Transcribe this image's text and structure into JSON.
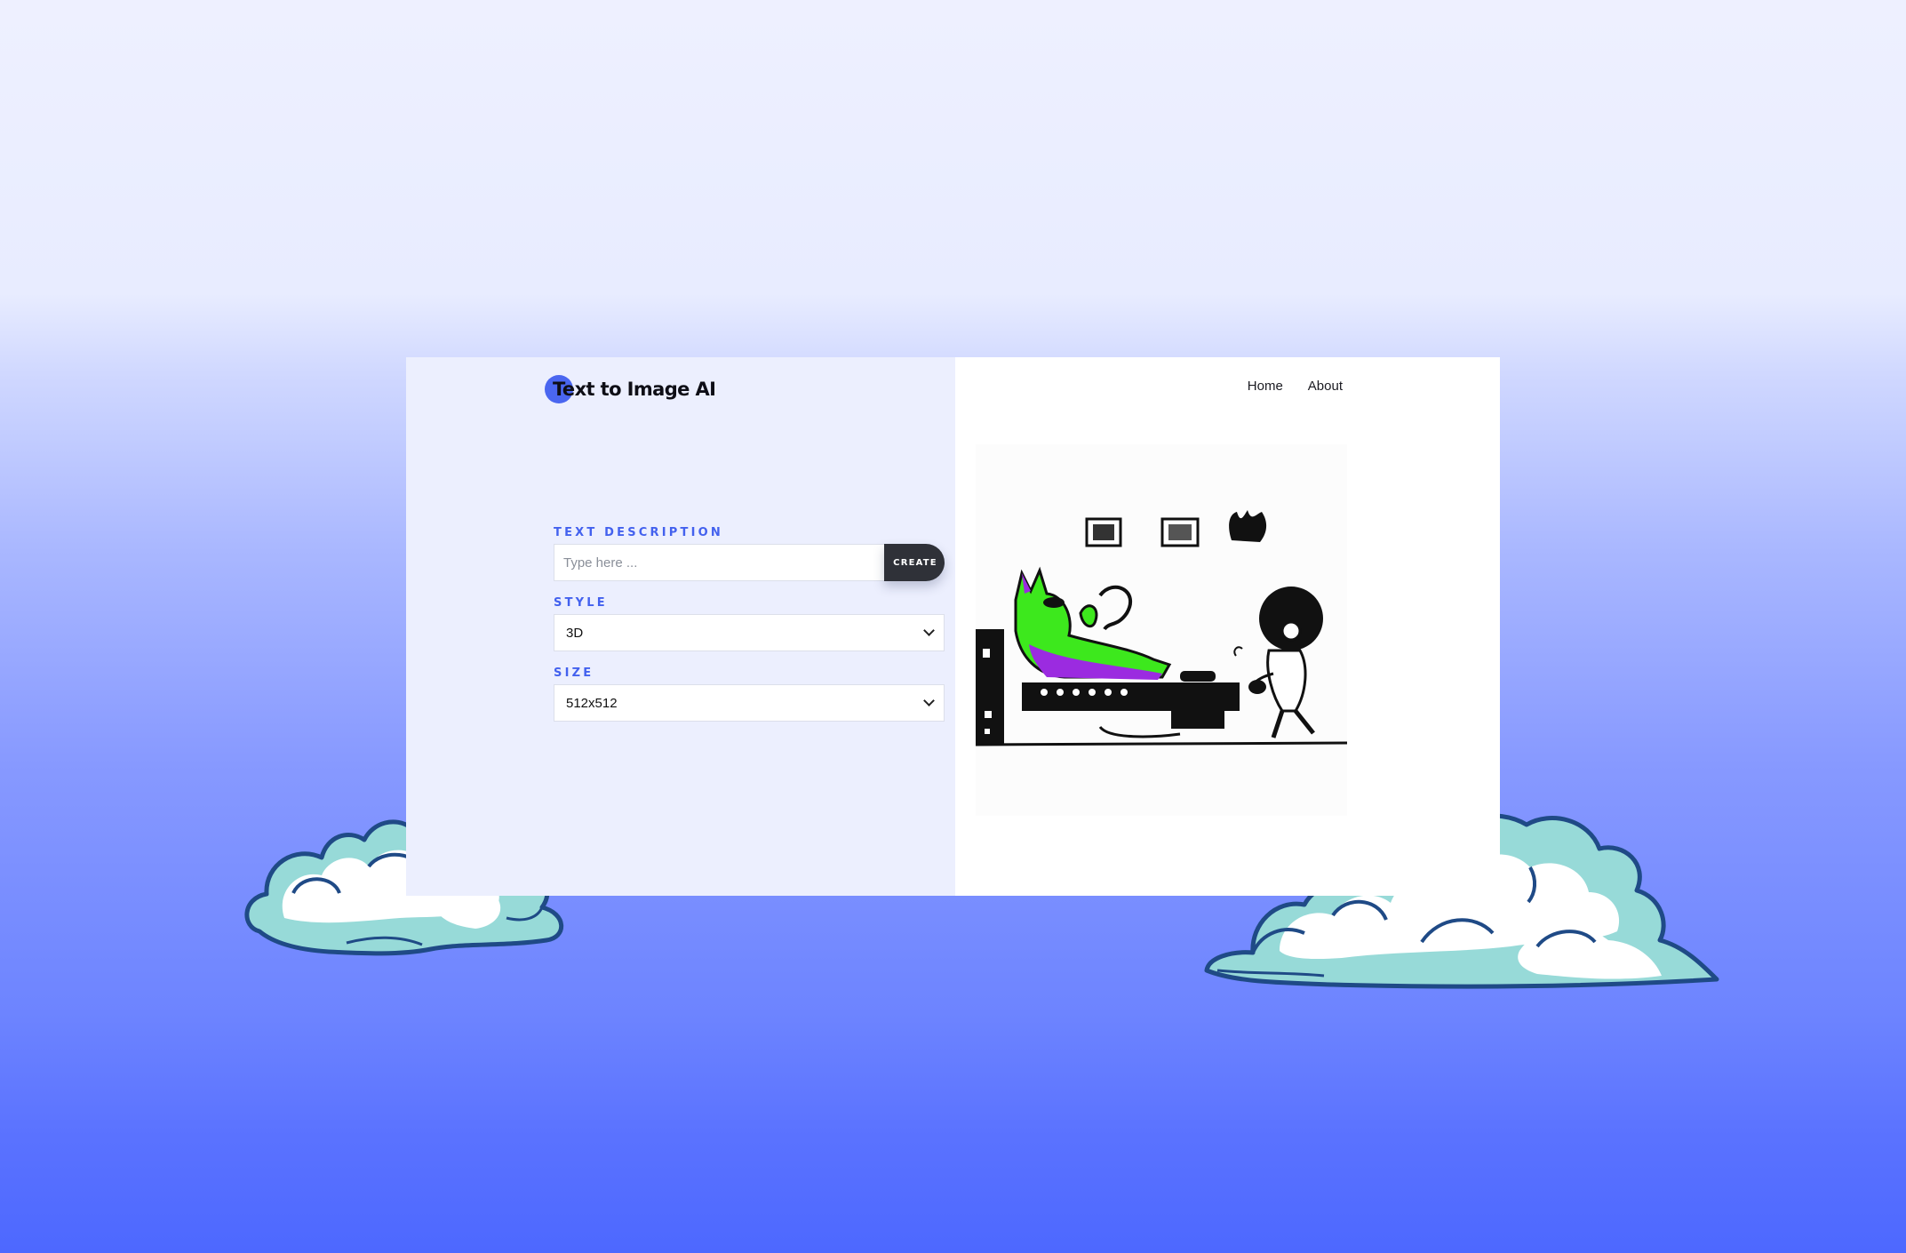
{
  "app": {
    "title": "Text to Image AI"
  },
  "nav": {
    "items": [
      {
        "label": "Home"
      },
      {
        "label": "About"
      }
    ]
  },
  "form": {
    "text_description": {
      "label": "TEXT DESCRIPTION",
      "placeholder": "Type here ...",
      "value": ""
    },
    "create_button": {
      "label": "CREATE"
    },
    "style": {
      "label": "STYLE",
      "selected": "3D"
    },
    "size": {
      "label": "SIZE",
      "selected": "512x512"
    }
  },
  "colors": {
    "accent": "#4361ee",
    "button": "#2f3138",
    "left_panel": "#eceffe",
    "cloud_teal": "#97dad8",
    "cloud_outline": "#1f4a86"
  }
}
